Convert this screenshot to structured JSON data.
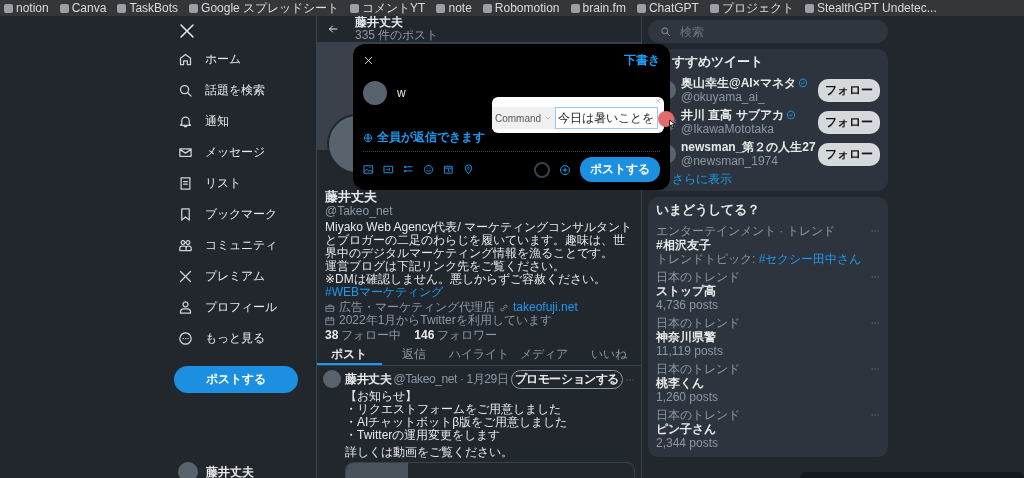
{
  "bookmarks": [
    {
      "label": "notion"
    },
    {
      "label": "Canva"
    },
    {
      "label": "TaskBots"
    },
    {
      "label": "Google スプレッドシート"
    },
    {
      "label": "コメントYT"
    },
    {
      "label": "note"
    },
    {
      "label": "Robomotion"
    },
    {
      "label": "brain.fm"
    },
    {
      "label": "ChatGPT"
    },
    {
      "label": "プロジェクト"
    },
    {
      "label": "StealthGPT Undetec..."
    }
  ],
  "nav": {
    "items": [
      {
        "kind": "home",
        "label": "ホーム"
      },
      {
        "kind": "search",
        "label": "話題を検索"
      },
      {
        "kind": "bell",
        "label": "通知"
      },
      {
        "kind": "mail",
        "label": "メッセージ"
      },
      {
        "kind": "list",
        "label": "リスト"
      },
      {
        "kind": "bookmark",
        "label": "ブックマーク"
      },
      {
        "kind": "people",
        "label": "コミュニティ"
      },
      {
        "kind": "x",
        "label": "プレミアム"
      },
      {
        "kind": "person",
        "label": "プロフィール"
      },
      {
        "kind": "more",
        "label": "もっと見る"
      }
    ],
    "post_button": "ポストする",
    "account_name": "藤井丈夫"
  },
  "profile": {
    "header_name": "藤井丈夫",
    "post_count": "335 件のポスト",
    "name": "藤井丈夫",
    "handle": "@Takeo_net",
    "bio": [
      "Miyako Web Agency代表/ マーケティングコンサルタントとブロガーの二足のわらじを履いています。趣味は、世界中のデジタルマーケティング情報を漁ることです。",
      "運営ブログは下記リンク先をご覧ください。",
      "※DMは確認しません。悪しからずご容赦ください。"
    ],
    "hashtag": "#WEBマーケティング",
    "category": "広告・マーケティング代理店",
    "website": "takeofuji.net",
    "joined": "2022年1月からTwitterを利用しています",
    "following_count": "38",
    "following_label": "フォロー中",
    "followers_count": "146",
    "followers_label": "フォロワー",
    "tabs": [
      {
        "label": "ポスト",
        "selected": true
      },
      {
        "label": "返信",
        "selected": false
      },
      {
        "label": "ハイライト",
        "selected": false
      },
      {
        "label": "メディア",
        "selected": false
      },
      {
        "label": "いいね",
        "selected": false
      }
    ]
  },
  "post": {
    "name": "藤井丈夫",
    "meta": "@Takeo_net · 1月29日",
    "promote_button": "プロモーションする",
    "paragraphs": [
      [
        "【お知らせ】",
        "・リクエストフォームをご用意しました",
        "・AIチャットボットβ版をご用意しました",
        "・Twitterの運用変更をします"
      ],
      [
        "詳しくは動画をご覧ください。"
      ]
    ]
  },
  "compose": {
    "drafts": "下書き",
    "text": "w",
    "reply_setting": "全員が返信できます",
    "post_button": "ポストする",
    "popup": {
      "select": "Command",
      "value": "今日は暑いことを"
    }
  },
  "search": {
    "placeholder": "検索"
  },
  "recommend": {
    "title": "すすめツイート",
    "users": [
      {
        "name": "奥山幸生@AI×マネタ",
        "handle": "@okuyama_ai_",
        "verified": true,
        "button": "フォロー"
      },
      {
        "name": "井川 直高 サブアカ",
        "handle": "@IkawaMototaka",
        "verified": true,
        "button": "フォロー"
      },
      {
        "name": "newsman_第２の人生27",
        "handle": "@newsman_1974",
        "verified": false,
        "button": "フォロー"
      }
    ],
    "more": "さらに表示"
  },
  "trends": {
    "title": "いまどうしてる？",
    "items": [
      {
        "context": "エンターテインメント · トレンド",
        "topic": "#相沢友子",
        "detail": "トレンドトピック: ",
        "detail_link": "#セクシー田中さん"
      },
      {
        "context": "日本のトレンド",
        "topic": "ストップ高",
        "detail": "4,736 posts"
      },
      {
        "context": "日本のトレンド",
        "topic": "神奈川県警",
        "detail": "11,119 posts"
      },
      {
        "context": "日本のトレンド",
        "topic": "桃李くん",
        "detail": "1,260 posts"
      },
      {
        "context": "日本のトレンド",
        "topic": "ピン子さん",
        "detail": "2,344 posts"
      }
    ]
  }
}
